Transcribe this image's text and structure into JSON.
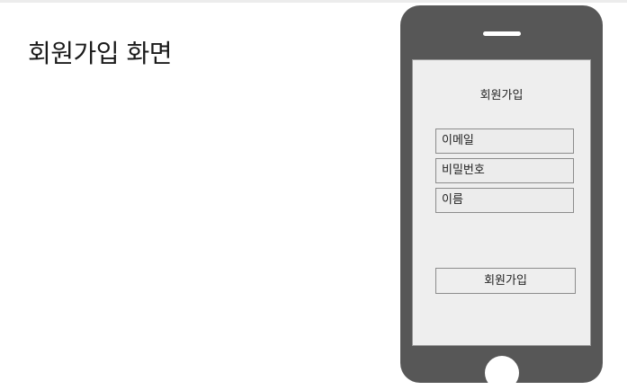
{
  "page": {
    "title": "회원가입 화면"
  },
  "phone": {
    "screen_title": "회원가입",
    "fields": [
      {
        "label": "이메일"
      },
      {
        "label": "비밀번호"
      },
      {
        "label": "이름"
      }
    ],
    "submit_label": "회원가입"
  },
  "colors": {
    "phone_body": "#575757",
    "screen_bg": "#eeeeee",
    "border": "#8c8c8c"
  }
}
